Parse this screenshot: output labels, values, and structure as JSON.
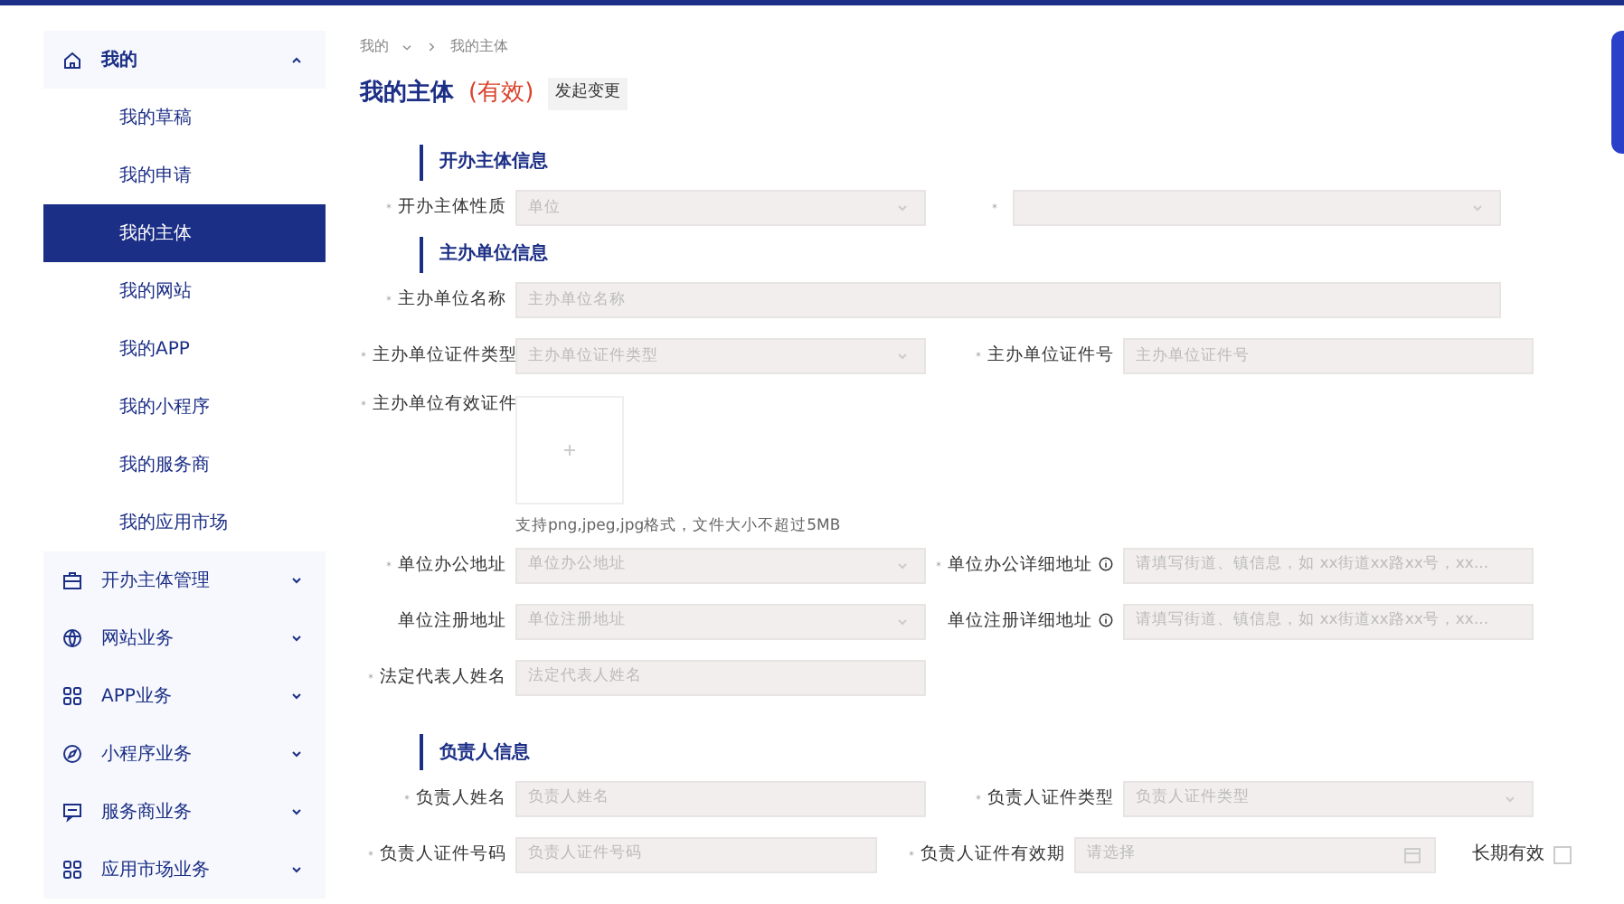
{
  "sidebar": {
    "items": [
      {
        "label": "我的",
        "expanded": true,
        "children": [
          {
            "label": "我的草稿",
            "selected": false
          },
          {
            "label": "我的申请",
            "selected": false
          },
          {
            "label": "我的主体",
            "selected": true
          },
          {
            "label": "我的网站",
            "selected": false
          },
          {
            "label": "我的APP",
            "selected": false
          },
          {
            "label": "我的小程序",
            "selected": false
          },
          {
            "label": "我的服务商",
            "selected": false
          },
          {
            "label": "我的应用市场",
            "selected": false
          }
        ]
      },
      {
        "label": "开办主体管理",
        "expanded": false
      },
      {
        "label": "网站业务",
        "expanded": false
      },
      {
        "label": "APP业务",
        "expanded": false
      },
      {
        "label": "小程序业务",
        "expanded": false
      },
      {
        "label": "服务商业务",
        "expanded": false
      },
      {
        "label": "应用市场业务",
        "expanded": false
      }
    ]
  },
  "breadcrumb": [
    {
      "label": "我的",
      "dropdown": true
    },
    {
      "label": "我的主体",
      "dropdown": false
    }
  ],
  "page": {
    "title": "我的主体",
    "status": "(有效)",
    "action": "发起变更"
  },
  "sections": [
    {
      "title": "开办主体信息",
      "rows": [
        [
          {
            "label": "开办主体性质",
            "required": true,
            "kind": "select",
            "value": "单位"
          },
          {
            "required": true,
            "kind": "select",
            "wide": true
          }
        ]
      ]
    },
    {
      "title": "主办单位信息",
      "rows": [
        [
          {
            "label": "主办单位名称",
            "required": true,
            "kind": "text",
            "placeholder": "主办单位名称",
            "wide": true
          }
        ],
        [
          {
            "label": "主办单位证件类型",
            "required": true,
            "kind": "select",
            "placeholder": "主办单位证件类型"
          },
          {
            "label": "主办单位证件号",
            "required": true,
            "kind": "text",
            "placeholder": "主办单位证件号"
          }
        ],
        [
          {
            "label": "主办单位有效证件",
            "required": true,
            "kind": "upload",
            "hint": "支持png,jpeg,jpg格式，文件大小不超过5MB"
          }
        ],
        [
          {
            "label": "单位办公地址",
            "required": true,
            "kind": "select",
            "placeholder": "单位办公地址"
          },
          {
            "label": "单位办公详细地址",
            "required": true,
            "info": true,
            "kind": "text",
            "placeholder": "请填写街道、镇信息，如 xx街道xx路xx号，xx..."
          }
        ],
        [
          {
            "label": "单位注册地址",
            "required": false,
            "kind": "select",
            "placeholder": "单位注册地址"
          },
          {
            "label": "单位注册详细地址",
            "required": false,
            "info": true,
            "kind": "text",
            "placeholder": "请填写街道、镇信息，如 xx街道xx路xx号，xx..."
          }
        ],
        [
          {
            "label": "法定代表人姓名",
            "required": true,
            "kind": "text",
            "placeholder": "法定代表人姓名"
          }
        ]
      ]
    },
    {
      "title": "负责人信息",
      "rows": [
        [
          {
            "label": "负责人姓名",
            "required": true,
            "kind": "text",
            "placeholder": "负责人姓名"
          },
          {
            "label": "负责人证件类型",
            "required": true,
            "kind": "select",
            "placeholder": "负责人证件类型"
          }
        ],
        [
          {
            "label": "负责人证件号码",
            "required": true,
            "kind": "text",
            "placeholder": "负责人证件号码"
          },
          {
            "label": "负责人证件有效期",
            "required": true,
            "kind": "date",
            "placeholder": "请选择"
          },
          {
            "label": "长期有效",
            "kind": "checkbox",
            "checked": false
          }
        ]
      ]
    }
  ]
}
